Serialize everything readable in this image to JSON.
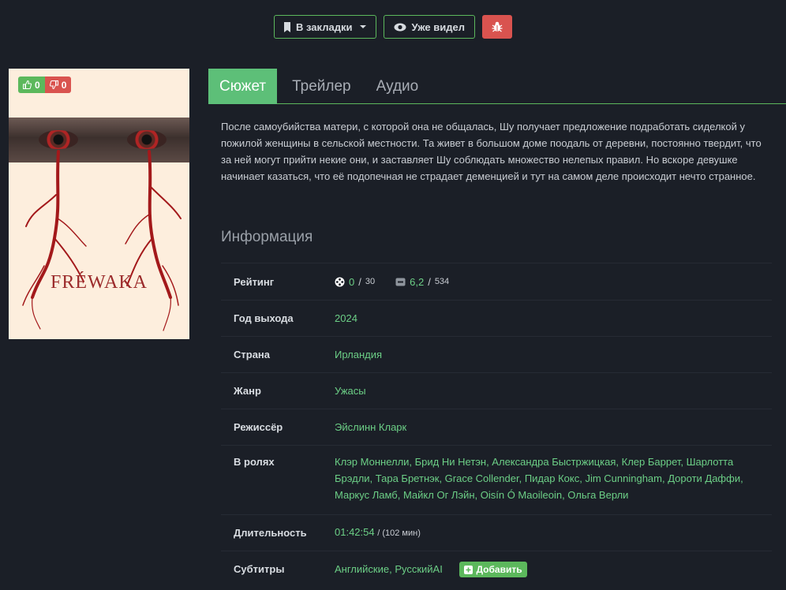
{
  "toolbar": {
    "bookmark_label": "В закладки",
    "seen_label": "Уже видел",
    "bookmark_icon": "bookmark-icon",
    "seen_icon": "eye-icon",
    "bug_icon": "bug-icon"
  },
  "poster": {
    "title": "FRÉWAKA",
    "likes": "0",
    "dislikes": "0"
  },
  "tabs": [
    {
      "label": "Сюжет"
    },
    {
      "label": "Трейлер"
    },
    {
      "label": "Аудио"
    }
  ],
  "plot": "После самоубийства матери, с которой она не общалась, Шу получает предложение подработать сиделкой у пожилой женщины в сельской местности. Та живет в большом доме поодаль от деревни, постоянно твердит, что за ней могут прийти некие они, и заставляет Шу соблюдать множество нелепых правил. Но вскоре девушке начинает казаться, что её подопечная не страдает деменцией и тут на самом деле происходит нечто странное.",
  "info": {
    "title": "Информация",
    "rating_label": "Рейтинг",
    "rating1_value": "0",
    "rating1_sep": "/",
    "rating1_votes": "30",
    "rating2_value": "6,2",
    "rating2_sep": "/",
    "rating2_votes": "534",
    "year_label": "Год выхода",
    "year": "2024",
    "country_label": "Страна",
    "country": "Ирландия",
    "genre_label": "Жанр",
    "genre": "Ужасы",
    "director_label": "Режиссёр",
    "director": "Эйслинн Кларк",
    "cast_label": "В ролях",
    "cast": "Клэр Моннелли, Брид Ни Нетэн, Александра Быстржицкая, Клер Баррет, Шарлотта Брэдли, Тара Бретнэк, Grace Collender, Пидар Кокс, Jim Cunningham, Дороти Даффи, Маркус Ламб, Майкл Ог Лэйн, Oisín Ó Maoileoin, Ольга Верли",
    "duration_label": "Длительность",
    "duration": "01:42:54",
    "duration_minutes": "/ (102 мин)",
    "subtitles_label": "Субтитры",
    "subtitles": "Английские, РусскийAI",
    "add_label": "Добавить"
  },
  "colors": {
    "accent": "#5cb85c",
    "danger": "#d9534f",
    "background": "#1b1f27"
  }
}
